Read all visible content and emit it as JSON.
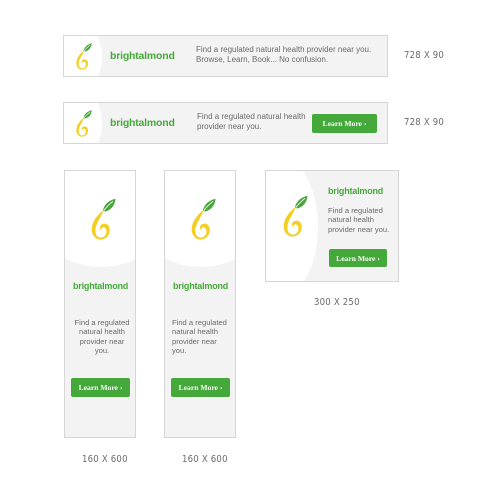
{
  "brand": {
    "name": "brightalmond",
    "primary_color": "#47a83b",
    "leaf_color": "#4aa63c",
    "almond_color": "#f2cf22"
  },
  "tagline_long": "Find a regulated natural health provider near you. Browse, Learn, Book... No confusion.",
  "tagline_short": "Find a regulated natural health provider near you.",
  "cta_label": "Learn More ›",
  "sizes": {
    "leaderboard": "728 X 90",
    "rectangle": "300 X 250",
    "skyscraper": "160 X 600"
  },
  "logo_icon": "leaf-almond-icon"
}
